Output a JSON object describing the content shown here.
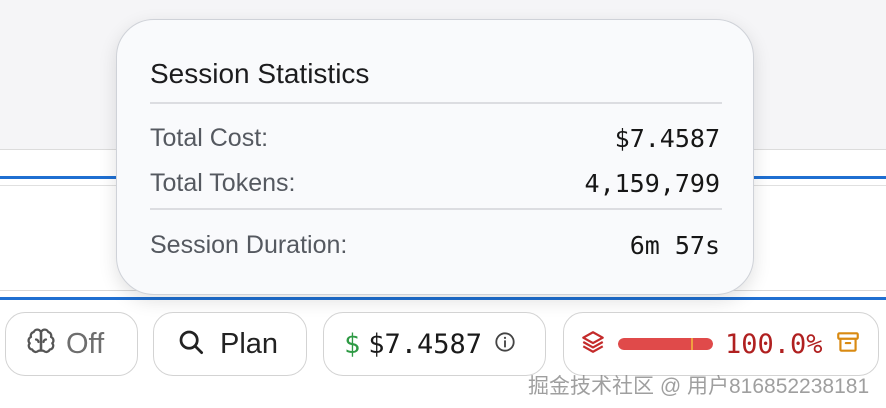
{
  "popover": {
    "title": "Session Statistics",
    "rows": [
      {
        "label": "Total Cost:",
        "value": "$7.4587"
      },
      {
        "label": "Total Tokens:",
        "value": "4,159,799"
      },
      {
        "label": "Session Duration:",
        "value": "6m 57s"
      }
    ]
  },
  "toolbar": {
    "thinking_label": "Off",
    "plan_label": "Plan",
    "cost_symbol": "$",
    "cost_value": "$7.4587",
    "context_percent_text": "100.0%",
    "context_fill": 1.0
  },
  "icons": {
    "thinking": "brain-icon",
    "plan": "search-icon",
    "cost": "dollar-icon",
    "info": "info-icon",
    "context": "layers-icon",
    "archive": "archive-icon"
  },
  "colors": {
    "accent_blue": "#1f6fd1",
    "cost_green": "#2e9a44",
    "context_red": "#e04a4a",
    "context_text": "#b02020"
  },
  "watermark": "掘金技术社区 @ 用户816852238181"
}
